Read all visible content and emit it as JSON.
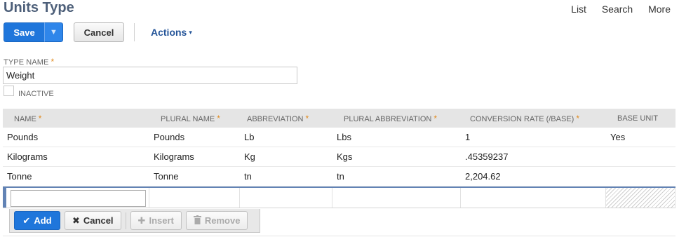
{
  "page": {
    "title": "Units Type"
  },
  "top_nav": {
    "list": "List",
    "search": "Search",
    "more": "More"
  },
  "toolbar": {
    "save_label": "Save",
    "save_menu_icon": "▼",
    "cancel_label": "Cancel",
    "actions_label": "Actions",
    "actions_caret": "▾"
  },
  "form": {
    "type_name_label": "TYPE NAME",
    "required_marker": "*",
    "type_name_value": "Weight",
    "inactive_label": "INACTIVE",
    "inactive_checked": false
  },
  "grid": {
    "columns": [
      {
        "label": "NAME",
        "required": "*"
      },
      {
        "label": "PLURAL NAME",
        "required": "*"
      },
      {
        "label": "ABBREVIATION",
        "required": "*"
      },
      {
        "label": "PLURAL ABBREVIATION",
        "required": "*"
      },
      {
        "label": "CONVERSION RATE (/BASE)",
        "required": "*"
      },
      {
        "label": "BASE UNIT",
        "required": ""
      }
    ],
    "rows": [
      [
        "Pounds",
        "Pounds",
        "Lb",
        "Lbs",
        "1",
        "Yes"
      ],
      [
        "Kilograms",
        "Kilograms",
        "Kg",
        "Kgs",
        ".45359237",
        ""
      ],
      [
        "Tonne",
        "Tonne",
        "tn",
        "tn",
        "2,204.62",
        ""
      ]
    ]
  },
  "row_actions": {
    "add_label": "Add",
    "cancel_label": "Cancel",
    "insert_label": "Insert",
    "remove_label": "Remove"
  },
  "icons": {
    "add": "check-icon",
    "cancel": "x-icon",
    "insert": "plus-icon",
    "remove": "trash-icon"
  },
  "colors": {
    "primary": "#1f76db",
    "title": "#4d5f79",
    "actions": "#255599",
    "required": "#e08a1e"
  }
}
